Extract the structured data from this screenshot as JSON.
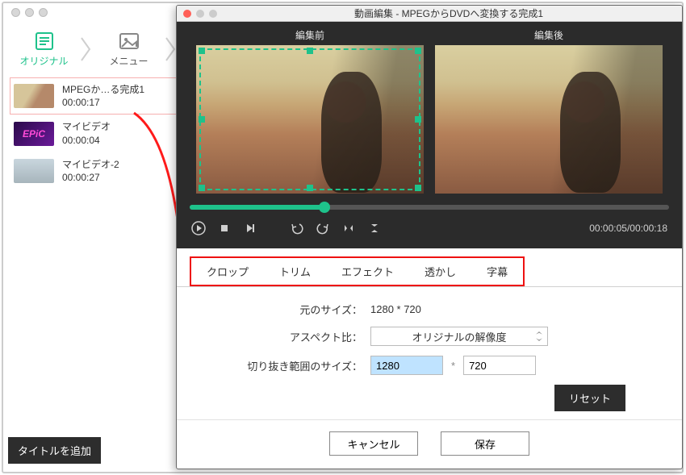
{
  "wizard": {
    "step1": "オリジナル",
    "step2": "メニュー"
  },
  "clips": [
    {
      "title": "MPEGか…る完成1",
      "duration": "00:00:17"
    },
    {
      "title": "マイビデオ",
      "duration": "00:00:04",
      "thumb_text": "EPiC"
    },
    {
      "title": "マイビデオ-2",
      "duration": "00:00:27"
    }
  ],
  "add_title_btn": "タイトルを追加",
  "modal": {
    "title": "動画編集 - MPEGからDVDへ変換する完成1",
    "before_label": "編集前",
    "after_label": "編集後",
    "time_readout": "00:00:05/00:00:18",
    "tabs": {
      "crop": "クロップ",
      "trim": "トリム",
      "effect": "エフェクト",
      "watermark": "透かし",
      "subtitle": "字幕"
    },
    "form": {
      "orig_size_label": "元のサイズ：",
      "orig_size_value": "1280 * 720",
      "aspect_label": "アスペクト比：",
      "aspect_value": "オリジナルの解像度",
      "crop_size_label": "切り抜き範囲のサイズ：",
      "crop_w": "1280",
      "crop_h": "720"
    },
    "reset_btn": "リセット",
    "cancel_btn": "キャンセル",
    "save_btn": "保存"
  }
}
